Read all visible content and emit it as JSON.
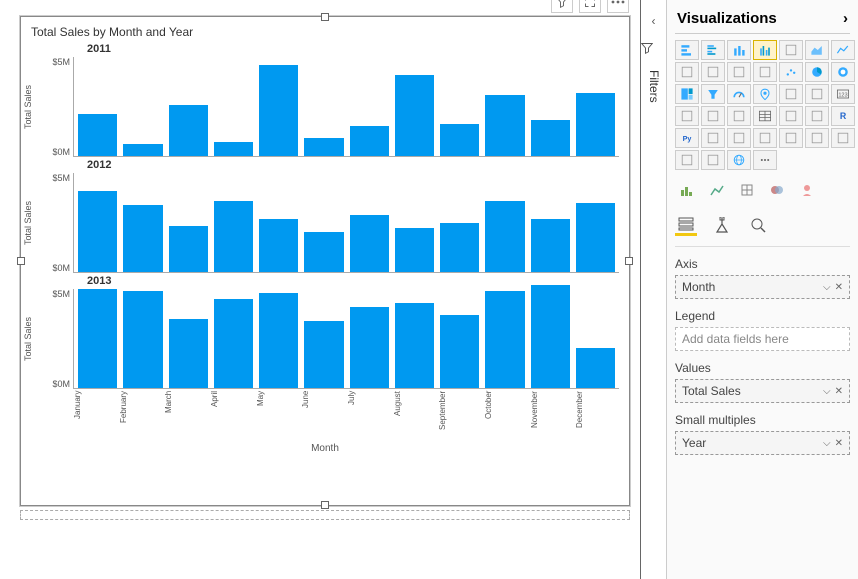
{
  "viz": {
    "title": "Total Sales by Month and Year",
    "toolbar": {
      "filter": "filter-icon",
      "focus": "focus-icon",
      "more": "more-icon"
    }
  },
  "filters_label": "Filters",
  "chart_data": [
    {
      "type": "bar",
      "year": "2011",
      "ylabel": "Total Sales",
      "yticks": [
        "$5M",
        "$0M"
      ],
      "ylim": [
        0,
        5
      ],
      "categories": [
        "January",
        "February",
        "March",
        "April",
        "May",
        "June",
        "July",
        "August",
        "September",
        "October",
        "November",
        "December"
      ],
      "values": [
        2.1,
        0.6,
        2.6,
        0.7,
        4.6,
        0.9,
        1.5,
        4.1,
        1.6,
        3.1,
        1.8,
        3.2
      ]
    },
    {
      "type": "bar",
      "year": "2012",
      "ylabel": "Total Sales",
      "yticks": [
        "$5M",
        "$0M"
      ],
      "ylim": [
        0,
        5
      ],
      "categories": [
        "January",
        "February",
        "March",
        "April",
        "May",
        "June",
        "July",
        "August",
        "September",
        "October",
        "November",
        "December"
      ],
      "values": [
        4.1,
        3.4,
        2.3,
        3.6,
        2.7,
        2.0,
        2.9,
        2.2,
        2.5,
        3.6,
        2.7,
        3.5
      ]
    },
    {
      "type": "bar",
      "year": "2013",
      "ylabel": "Total Sales",
      "yticks": [
        "$5M",
        "$0M"
      ],
      "ylim": [
        0,
        5
      ],
      "categories": [
        "January",
        "February",
        "March",
        "April",
        "May",
        "June",
        "July",
        "August",
        "September",
        "October",
        "November",
        "December"
      ],
      "values": [
        5.0,
        4.9,
        3.5,
        4.5,
        4.8,
        3.4,
        4.1,
        4.3,
        3.7,
        4.9,
        5.2,
        2.0
      ]
    }
  ],
  "xaxis_title": "Month",
  "right": {
    "pane_title": "Visualizations",
    "gallery": [
      "stacked-bar",
      "clustered-bar",
      "stacked-column",
      "clustered-column",
      "stacked-column-100",
      "area",
      "line",
      "line-stacked",
      "line-clustered",
      "ribbon",
      "waterfall",
      "scatter",
      "pie",
      "donut",
      "treemap",
      "funnel",
      "gauge",
      "map",
      "filled-map",
      "azure-map",
      "card",
      "multi-row-card",
      "kpi",
      "slicer",
      "table",
      "matrix",
      "influencers",
      "r-visual",
      "py-visual",
      "decomposition",
      "qa",
      "key-driver",
      "narrative",
      "paginated",
      "script",
      "arcgis",
      "powerapps",
      "globe",
      "ellipsis"
    ],
    "selected_gallery_index": 3,
    "custom": [
      "custom-1",
      "custom-2",
      "custom-3",
      "custom-4",
      "custom-5"
    ],
    "tabs": {
      "fields": "Fields",
      "format": "Format",
      "analytics": "Analytics"
    },
    "wells": {
      "axis": {
        "label": "Axis",
        "value": "Month"
      },
      "legend": {
        "label": "Legend",
        "placeholder": "Add data fields here"
      },
      "values": {
        "label": "Values",
        "value": "Total Sales"
      },
      "small_multiples": {
        "label": "Small multiples",
        "value": "Year"
      }
    }
  }
}
